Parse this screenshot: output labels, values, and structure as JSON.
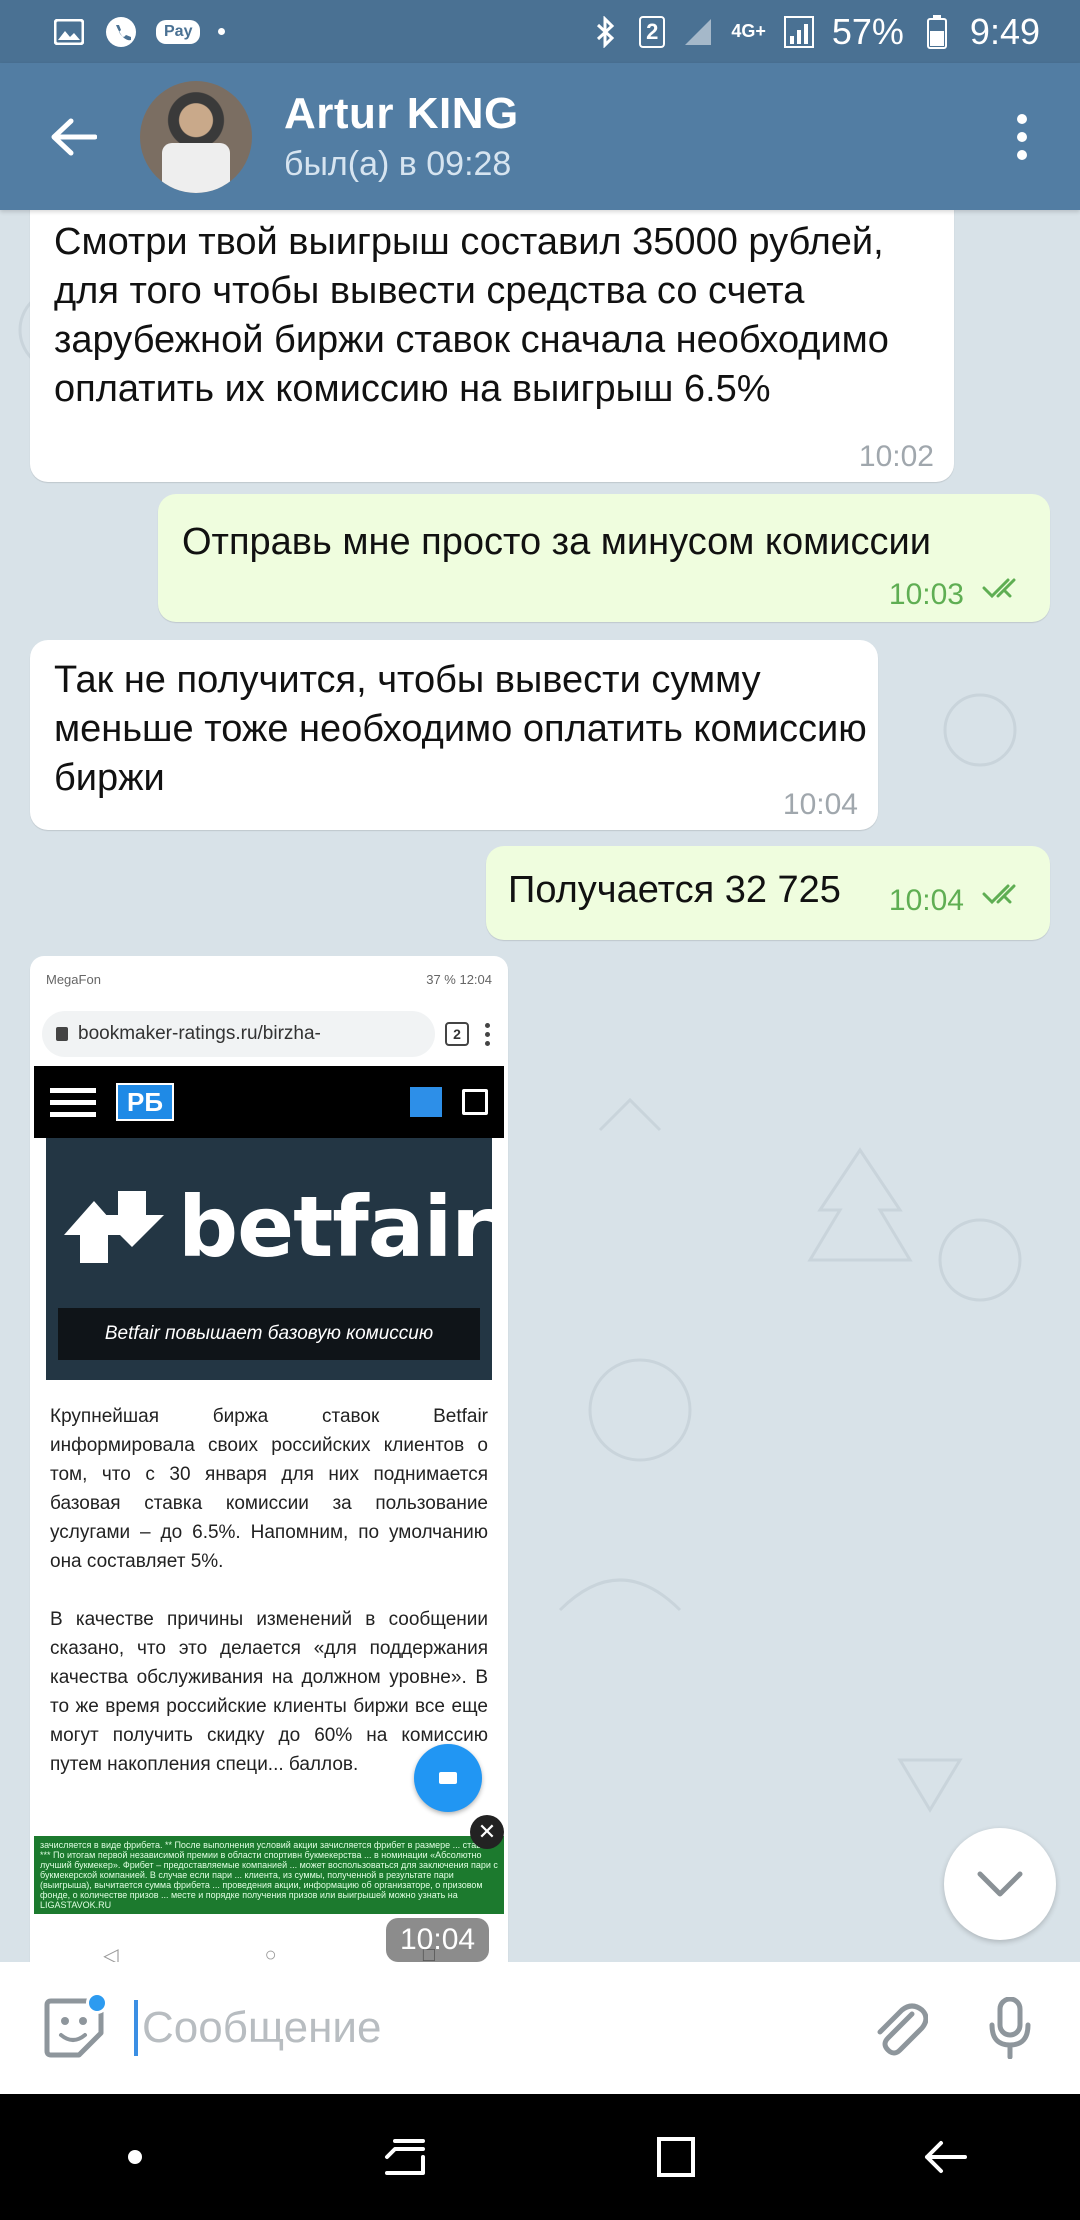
{
  "status_bar": {
    "badge": "Pay",
    "sim": "2",
    "network": "4G+",
    "battery": "57%",
    "time": "9:49"
  },
  "header": {
    "contact_name": "Artur KING",
    "last_seen": "был(а) в 09:28"
  },
  "messages": [
    {
      "direction": "in",
      "text": "Смотри твой выигрыш составил 35000 рублей, для того чтобы вывести средства со счета зарубежной биржи ставок сначала необходимо оплатить их комиссию на выигрыш 6.5%",
      "time": "10:02"
    },
    {
      "direction": "out",
      "text": "Отправь мне просто за минусом комиссии",
      "time": "10:03",
      "read": true
    },
    {
      "direction": "in",
      "text": "Так не получится, чтобы вывести сумму меньше тоже необходимо оплатить комиссию биржи",
      "time": "10:04"
    },
    {
      "direction": "out",
      "text": "Получается 32 725",
      "time": "10:04",
      "read": true
    }
  ],
  "image_message": {
    "time": "10:04",
    "screenshot": {
      "carrier": "MegaFon",
      "status_right": "37 %  12:04",
      "url": "bookmaker-ratings.ru/birzha-",
      "tab_count": "2",
      "site_logo": "РБ",
      "brand_text": "betfair",
      "banner_caption": "Betfair повышает базовую комиссию",
      "paragraph_1": "Крупнейшая биржа ставок Betfair информировала своих российских клиентов о том, что с 30 января для них поднимается базовая ставка комиссии за пользование услугами – до 6.5%. Напомним, по умолчанию она составляет 5%.",
      "paragraph_2": "В качестве причины изменений в сообщении сказано, что это делается «для поддержания качества обслуживания на должном уровне». В то же время российские клиенты биржи все еще могут получить скидку до 60% на комиссию путем накопления специ... баллов.",
      "footer_fineprint": "зачисляется в виде фрибета. ** После выполнения условий акции зачисляется фрибет в размере ... ставки. *** По итогам первой независимой премии в области спортивн букмекерства ... в номинации «Абсолютно лучший букмекер». Фрибет – предоставляемые компанией ... может воспользоваться для заключения пари с букмекерской компанией. В случае если пари ... клиента, из суммы, полученной в результате пари (выигрыша), вычитается сумма фрибета ... проведения акции, информацию об организаторе, о призовом фонде, о количестве призов ... месте и порядке получения призов или выигрышей можно узнать на LIGASTAVOK.RU"
    }
  },
  "input": {
    "placeholder": "Сообщение"
  },
  "colors": {
    "header_bg": "#527da3",
    "incoming_bubble": "#ffffff",
    "outgoing_bubble": "#effdde",
    "outgoing_time": "#5fae53",
    "accent": "#2d9bf0"
  },
  "icons": {
    "back": "arrow-left-icon",
    "menu": "more-vertical-icon",
    "emoji": "sticker-emoji-icon",
    "attach": "paperclip-icon",
    "mic": "microphone-icon",
    "scroll_down": "chevron-down-icon"
  }
}
